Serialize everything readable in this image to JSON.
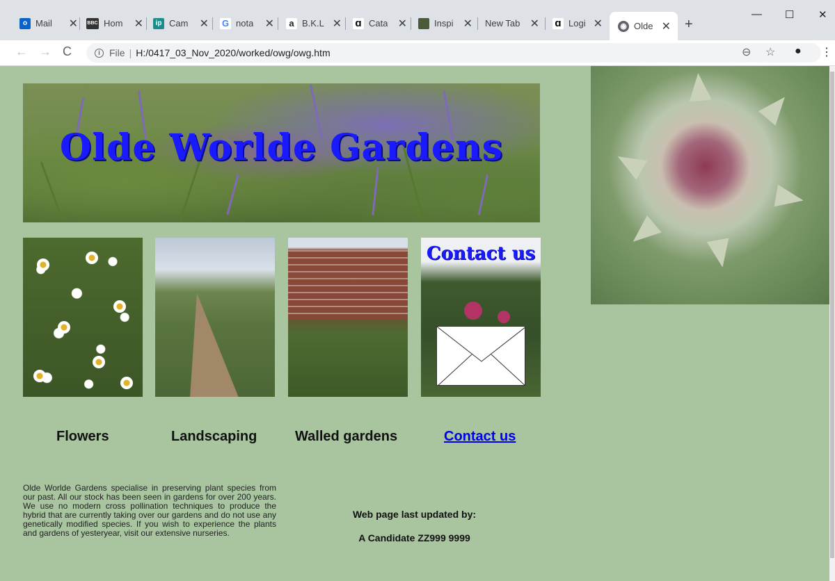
{
  "browser": {
    "tabs": [
      {
        "title": "Mail",
        "icon": "outlook-icon",
        "color": "#0a64c8"
      },
      {
        "title": "Hom",
        "icon": "bbc-icon",
        "color": "#333333"
      },
      {
        "title": "Cam",
        "icon": "ip-icon",
        "color": "#1a8c8c"
      },
      {
        "title": "nota",
        "icon": "google-icon",
        "color": "#4285f4"
      },
      {
        "title": "B.K.L",
        "icon": "amazon-icon",
        "color": "#222222"
      },
      {
        "title": "Cata",
        "icon": "swirl-icon",
        "color": "#000000"
      },
      {
        "title": "Inspi",
        "icon": "thumbnail-icon",
        "color": "#4b5a3a"
      },
      {
        "title": "New Tab",
        "icon": "",
        "color": ""
      },
      {
        "title": "Logi",
        "icon": "swirl-icon",
        "color": "#000000"
      }
    ],
    "active_tab": {
      "title": "Olde",
      "icon": "globe-icon"
    },
    "close_glyph": "✕",
    "new_tab_glyph": "+",
    "address": {
      "scheme": "File",
      "path": "H:/0417_03_Nov_2020/worked/owg/owg.htm"
    }
  },
  "page": {
    "banner_title": "Olde Worlde Gardens",
    "contact_image_text": "Contact us",
    "nav": {
      "flowers": "Flowers",
      "landscaping": "Landscaping",
      "walled": "Walled gardens",
      "contact": "Contact us"
    },
    "description": "Olde Worlde Gardens specialise in preserving plant species from our past. All our stock has been seen in gardens for over 200 years. We use no modern cross pollination techniques to produce the hybrid that are currently taking over our gardens and do not use any genetically modified species. If you wish to experience the plants and gardens of yesteryear, visit our extensive nurseries.",
    "updated_label": "Web page last updated by:",
    "updated_by": "A Candidate ZZ999 9999"
  },
  "colors": {
    "page_background": "#a8c5a0",
    "title_blue": "#1a1aff",
    "link": "#0000ee"
  }
}
